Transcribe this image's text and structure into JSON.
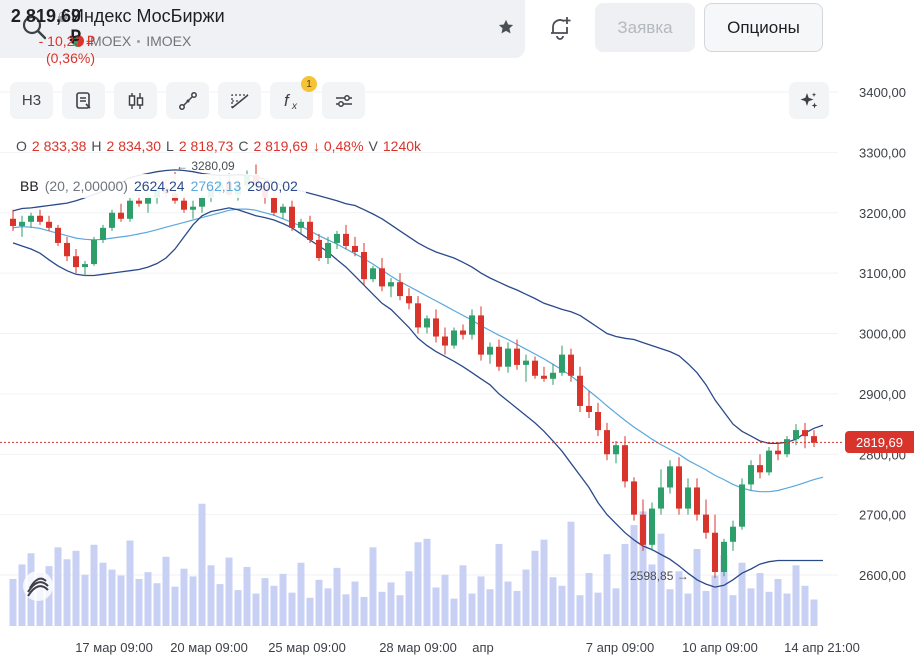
{
  "header": {
    "title": "Индекс МосБиржи",
    "exchange": "MOEX",
    "ticker": "IMOEX",
    "price": "2 819,69 ₽",
    "change": "- 10,23 ₽ (0,36%)",
    "order_label": "Заявка",
    "options_label": "Опционы",
    "icons": [
      "search-icon",
      "lock-icon",
      "star-icon",
      "bell-plus-icon"
    ]
  },
  "toolbar": {
    "timeframe": "Н3",
    "indicator_badge": "1",
    "icons": [
      "notes-icon",
      "candles-icon",
      "line-tool-icon",
      "fibonacci-icon",
      "function-icon",
      "settings-sliders-icon",
      "sparkle-icon"
    ]
  },
  "ohlc": {
    "o_label": "O",
    "o": "2 833,38",
    "h_label": "H",
    "h": "2 834,30",
    "l_label": "L",
    "l": "2 818,73",
    "c_label": "C",
    "c": "2 819,69",
    "change": "↓ 0,48%",
    "v_label": "V",
    "v": "1240k"
  },
  "bb": {
    "name": "BB",
    "params": "(20, 2,00000)",
    "lower": "2624,24",
    "middle": "2762,13",
    "upper": "2900,02"
  },
  "chart_data": {
    "type": "candlestick",
    "y_axis_labels": [
      "3400,00",
      "3300,00",
      "3200,00",
      "3100,00",
      "3000,00",
      "2900,00",
      "2800,00",
      "2700,00",
      "2600,00"
    ],
    "x_axis_labels": [
      "17 мар 09:00",
      "20 мар 09:00",
      "25 мар 09:00",
      "28 мар 09:00",
      "апр",
      "7 апр 09:00",
      "10 апр 09:00",
      "14 апр 21:00"
    ],
    "ylim": [
      2520,
      3430
    ],
    "current_price": 2819.69,
    "current_price_label": "2819,69",
    "max_annotation": "← 3280,09",
    "min_annotation": "2598,85 →",
    "colors": {
      "up": "#2e9e6a",
      "down": "#d9342b",
      "bb_outer": "#2b4a8a",
      "bb_mid": "#5aa8dd",
      "volume": "#c8d0f4"
    },
    "candles": [
      [
        3190,
        3205,
        3170,
        3178
      ],
      [
        3178,
        3195,
        3160,
        3185
      ],
      [
        3185,
        3200,
        3175,
        3195
      ],
      [
        3195,
        3205,
        3180,
        3185
      ],
      [
        3185,
        3195,
        3170,
        3175
      ],
      [
        3175,
        3180,
        3145,
        3150
      ],
      [
        3150,
        3160,
        3120,
        3128
      ],
      [
        3128,
        3140,
        3100,
        3110
      ],
      [
        3110,
        3120,
        3095,
        3115
      ],
      [
        3115,
        3160,
        3112,
        3155
      ],
      [
        3155,
        3180,
        3150,
        3175
      ],
      [
        3175,
        3205,
        3170,
        3200
      ],
      [
        3200,
        3215,
        3185,
        3190
      ],
      [
        3190,
        3225,
        3185,
        3220
      ],
      [
        3220,
        3235,
        3210,
        3215
      ],
      [
        3215,
        3230,
        3200,
        3225
      ],
      [
        3225,
        3245,
        3215,
        3240
      ],
      [
        3240,
        3255,
        3225,
        3232
      ],
      [
        3232,
        3245,
        3215,
        3220
      ],
      [
        3220,
        3230,
        3200,
        3205
      ],
      [
        3205,
        3220,
        3190,
        3210
      ],
      [
        3210,
        3230,
        3200,
        3225
      ],
      [
        3225,
        3245,
        3218,
        3240
      ],
      [
        3240,
        3260,
        3230,
        3250
      ],
      [
        3250,
        3265,
        3228,
        3230
      ],
      [
        3230,
        3255,
        3220,
        3245
      ],
      [
        3245,
        3270,
        3238,
        3262
      ],
      [
        3262,
        3280,
        3240,
        3245
      ],
      [
        3245,
        3255,
        3215,
        3225
      ],
      [
        3225,
        3232,
        3195,
        3200
      ],
      [
        3200,
        3215,
        3190,
        3210
      ],
      [
        3210,
        3220,
        3170,
        3175
      ],
      [
        3175,
        3190,
        3165,
        3185
      ],
      [
        3185,
        3195,
        3150,
        3155
      ],
      [
        3155,
        3165,
        3120,
        3125
      ],
      [
        3125,
        3160,
        3115,
        3150
      ],
      [
        3150,
        3170,
        3140,
        3165
      ],
      [
        3165,
        3180,
        3140,
        3145
      ],
      [
        3145,
        3160,
        3128,
        3135
      ],
      [
        3135,
        3150,
        3080,
        3090
      ],
      [
        3090,
        3112,
        3085,
        3108
      ],
      [
        3108,
        3125,
        3070,
        3078
      ],
      [
        3078,
        3092,
        3060,
        3085
      ],
      [
        3085,
        3100,
        3055,
        3062
      ],
      [
        3062,
        3075,
        3040,
        3050
      ],
      [
        3050,
        3062,
        3000,
        3010
      ],
      [
        3010,
        3030,
        3000,
        3025
      ],
      [
        3025,
        3040,
        2985,
        2995
      ],
      [
        2995,
        3010,
        2965,
        2980
      ],
      [
        2980,
        3010,
        2975,
        3005
      ],
      [
        3005,
        3015,
        2990,
        2998
      ],
      [
        2998,
        3040,
        2990,
        3030
      ],
      [
        3030,
        3045,
        2955,
        2965
      ],
      [
        2965,
        2985,
        2950,
        2978
      ],
      [
        2978,
        2990,
        2938,
        2945
      ],
      [
        2945,
        2985,
        2935,
        2975
      ],
      [
        2975,
        2990,
        2940,
        2948
      ],
      [
        2948,
        2965,
        2920,
        2955
      ],
      [
        2955,
        2962,
        2925,
        2930
      ],
      [
        2930,
        2945,
        2920,
        2925
      ],
      [
        2925,
        2950,
        2915,
        2935
      ],
      [
        2935,
        2980,
        2930,
        2965
      ],
      [
        2965,
        2975,
        2920,
        2930
      ],
      [
        2930,
        2945,
        2870,
        2880
      ],
      [
        2880,
        2905,
        2860,
        2870
      ],
      [
        2870,
        2885,
        2830,
        2840
      ],
      [
        2840,
        2852,
        2790,
        2800
      ],
      [
        2800,
        2822,
        2785,
        2815
      ],
      [
        2815,
        2830,
        2745,
        2755
      ],
      [
        2755,
        2762,
        2690,
        2700
      ],
      [
        2700,
        2725,
        2640,
        2650
      ],
      [
        2650,
        2720,
        2640,
        2710
      ],
      [
        2710,
        2775,
        2700,
        2745
      ],
      [
        2745,
        2790,
        2735,
        2780
      ],
      [
        2780,
        2795,
        2700,
        2710
      ],
      [
        2710,
        2760,
        2700,
        2745
      ],
      [
        2745,
        2760,
        2690,
        2700
      ],
      [
        2700,
        2725,
        2660,
        2670
      ],
      [
        2670,
        2700,
        2595,
        2605
      ],
      [
        2605,
        2660,
        2598,
        2655
      ],
      [
        2655,
        2690,
        2640,
        2680
      ],
      [
        2680,
        2760,
        2675,
        2750
      ],
      [
        2750,
        2790,
        2740,
        2782
      ],
      [
        2782,
        2800,
        2760,
        2770
      ],
      [
        2770,
        2812,
        2765,
        2806
      ],
      [
        2806,
        2820,
        2790,
        2800
      ],
      [
        2800,
        2830,
        2795,
        2825
      ],
      [
        2825,
        2850,
        2815,
        2840
      ],
      [
        2840,
        2852,
        2810,
        2830
      ],
      [
        2830,
        2840,
        2812,
        2819
      ]
    ],
    "volumes": [
      55,
      72,
      85,
      62,
      70,
      92,
      78,
      88,
      60,
      95,
      74,
      66,
      59,
      100,
      55,
      63,
      50,
      81,
      46,
      67,
      58,
      143,
      71,
      49,
      80,
      42,
      69,
      38,
      56,
      47,
      61,
      39,
      74,
      33,
      54,
      44,
      68,
      37,
      52,
      34,
      92,
      40,
      51,
      36,
      64,
      98,
      102,
      45,
      60,
      32,
      71,
      38,
      58,
      43,
      96,
      52,
      41,
      66,
      88,
      101,
      57,
      47,
      122,
      36,
      62,
      39,
      84,
      44,
      96,
      118,
      134,
      72,
      108,
      43,
      64,
      38,
      90,
      41,
      59,
      83,
      36,
      74,
      44,
      62,
      40,
      55,
      38,
      71,
      47,
      31
    ]
  },
  "bb_series": {
    "upper": [
      3203,
      3207,
      3208,
      3210,
      3212,
      3214,
      3216,
      3220,
      3225,
      3230,
      3236,
      3242,
      3250,
      3258,
      3262,
      3265,
      3268,
      3270,
      3271,
      3270,
      3268,
      3265,
      3263,
      3262,
      3262,
      3263,
      3262,
      3260,
      3255,
      3250,
      3245,
      3240,
      3236,
      3232,
      3228,
      3224,
      3220,
      3215,
      3212,
      3205,
      3198,
      3190,
      3180,
      3170,
      3160,
      3150,
      3142,
      3135,
      3130,
      3125,
      3118,
      3110,
      3100,
      3092,
      3085,
      3078,
      3072,
      3065,
      3058,
      3050,
      3045,
      3040,
      3036,
      3030,
      3020,
      3010,
      3000,
      2995,
      2992,
      2990,
      2985,
      2980,
      2975,
      2970,
      2963,
      2950,
      2935,
      2915,
      2890,
      2870,
      2850,
      2838,
      2830,
      2822,
      2818,
      2818,
      2820,
      2825,
      2835,
      2843,
      2848
    ],
    "middle": [
      3175,
      3177,
      3176,
      3174,
      3170,
      3166,
      3162,
      3158,
      3156,
      3155,
      3156,
      3158,
      3160,
      3162,
      3165,
      3168,
      3172,
      3176,
      3180,
      3184,
      3188,
      3192,
      3196,
      3200,
      3204,
      3206,
      3206,
      3204,
      3200,
      3196,
      3190,
      3184,
      3178,
      3170,
      3162,
      3155,
      3148,
      3140,
      3132,
      3124,
      3115,
      3105,
      3095,
      3086,
      3078,
      3070,
      3062,
      3054,
      3046,
      3038,
      3030,
      3022,
      3013,
      3005,
      2997,
      2990,
      2982,
      2974,
      2966,
      2958,
      2949,
      2940,
      2930,
      2918,
      2905,
      2893,
      2880,
      2868,
      2856,
      2845,
      2835,
      2825,
      2816,
      2808,
      2800,
      2790,
      2782,
      2774,
      2765,
      2758,
      2750,
      2744,
      2740,
      2738,
      2738,
      2740,
      2744,
      2748,
      2753,
      2758,
      2762
    ],
    "lower": [
      3150,
      3145,
      3140,
      3133,
      3122,
      3112,
      3104,
      3098,
      3096,
      3096,
      3098,
      3100,
      3102,
      3104,
      3106,
      3110,
      3116,
      3125,
      3140,
      3160,
      3180,
      3195,
      3202,
      3205,
      3208,
      3205,
      3200,
      3195,
      3192,
      3188,
      3182,
      3175,
      3165,
      3155,
      3145,
      3135,
      3122,
      3110,
      3095,
      3080,
      3065,
      3050,
      3040,
      3025,
      3010,
      2992,
      2980,
      2970,
      2962,
      2954,
      2945,
      2935,
      2925,
      2915,
      2900,
      2888,
      2876,
      2864,
      2852,
      2838,
      2822,
      2805,
      2785,
      2765,
      2745,
      2720,
      2700,
      2685,
      2670,
      2658,
      2648,
      2642,
      2634,
      2626,
      2615,
      2603,
      2592,
      2585,
      2580,
      2583,
      2592,
      2603,
      2610,
      2618,
      2622,
      2624,
      2624,
      2624,
      2624,
      2624,
      2624
    ]
  }
}
